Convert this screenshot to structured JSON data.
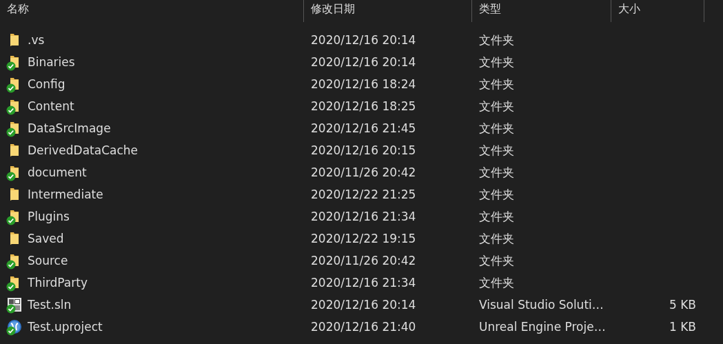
{
  "columns": [
    "名称",
    "修改日期",
    "类型",
    "大小"
  ],
  "rows": [
    {
      "kind": "folder",
      "name": ".vs",
      "modified": "2020/12/16 20:14",
      "type": "文件夹",
      "synced": false
    },
    {
      "kind": "folder",
      "name": "Binaries",
      "modified": "2020/12/16 20:14",
      "type": "文件夹",
      "synced": true
    },
    {
      "kind": "folder",
      "name": "Config",
      "modified": "2020/12/16 18:24",
      "type": "文件夹",
      "synced": true
    },
    {
      "kind": "folder",
      "name": "Content",
      "modified": "2020/12/16 18:25",
      "type": "文件夹",
      "synced": true
    },
    {
      "kind": "folder",
      "name": "DataSrcImage",
      "modified": "2020/12/16 21:45",
      "type": "文件夹",
      "synced": true
    },
    {
      "kind": "folder",
      "name": "DerivedDataCache",
      "modified": "2020/12/16 20:15",
      "type": "文件夹",
      "synced": false
    },
    {
      "kind": "folder",
      "name": "document",
      "modified": "2020/11/26 20:42",
      "type": "文件夹",
      "synced": true
    },
    {
      "kind": "folder",
      "name": "Intermediate",
      "modified": "2020/12/22 21:25",
      "type": "文件夹",
      "synced": false
    },
    {
      "kind": "folder",
      "name": "Plugins",
      "modified": "2020/12/16 21:34",
      "type": "文件夹",
      "synced": true
    },
    {
      "kind": "folder",
      "name": "Saved",
      "modified": "2020/12/22 19:15",
      "type": "文件夹",
      "synced": false
    },
    {
      "kind": "folder",
      "name": "Source",
      "modified": "2020/11/26 20:42",
      "type": "文件夹",
      "synced": true
    },
    {
      "kind": "folder",
      "name": "ThirdParty",
      "modified": "2020/12/16 21:34",
      "type": "文件夹",
      "synced": true
    },
    {
      "kind": "solution",
      "name": "Test.sln",
      "modified": "2020/12/16 20:14",
      "type": "Visual Studio Soluti…",
      "size": "5 KB",
      "synced": true
    },
    {
      "kind": "project",
      "name": "Test.uproject",
      "modified": "2020/12/16 21:40",
      "type": "Unreal Engine Proje…",
      "size": "1 KB",
      "synced": true
    }
  ]
}
